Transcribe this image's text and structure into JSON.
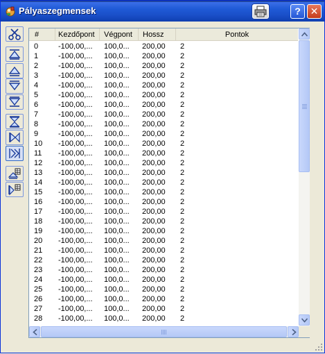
{
  "window": {
    "title": "Pályaszegmensek",
    "print_icon": "printer-icon",
    "help_label": "?",
    "close_label": "✕"
  },
  "toolbar": {
    "items": [
      {
        "name": "scissors-icon"
      },
      {
        "name": "move-to-top-icon"
      },
      {
        "name": "move-up-icon"
      },
      {
        "name": "move-down-icon"
      },
      {
        "name": "move-to-bottom-icon"
      },
      {
        "name": "flip-vertical-icon"
      },
      {
        "name": "flip-horizontal-icon"
      },
      {
        "name": "flip-both-icon"
      },
      {
        "name": "table-export-icon"
      },
      {
        "name": "table-import-icon"
      }
    ]
  },
  "table": {
    "columns": [
      "#",
      "Kezdőpont",
      "Végpont",
      "Hossz",
      "Pontok"
    ],
    "rows": [
      [
        "0",
        "-100,00,...",
        "100,0...",
        "200,00",
        "2"
      ],
      [
        "1",
        "-100,00,...",
        "100,0...",
        "200,00",
        "2"
      ],
      [
        "2",
        "-100,00,...",
        "100,0...",
        "200,00",
        "2"
      ],
      [
        "3",
        "-100,00,...",
        "100,0...",
        "200,00",
        "2"
      ],
      [
        "4",
        "-100,00,...",
        "100,0...",
        "200,00",
        "2"
      ],
      [
        "5",
        "-100,00,...",
        "100,0...",
        "200,00",
        "2"
      ],
      [
        "6",
        "-100,00,...",
        "100,0...",
        "200,00",
        "2"
      ],
      [
        "7",
        "-100,00,...",
        "100,0...",
        "200,00",
        "2"
      ],
      [
        "8",
        "-100,00,...",
        "100,0...",
        "200,00",
        "2"
      ],
      [
        "9",
        "-100,00,...",
        "100,0...",
        "200,00",
        "2"
      ],
      [
        "10",
        "-100,00,...",
        "100,0...",
        "200,00",
        "2"
      ],
      [
        "11",
        "-100,00,...",
        "100,0...",
        "200,00",
        "2"
      ],
      [
        "12",
        "-100,00,...",
        "100,0...",
        "200,00",
        "2"
      ],
      [
        "13",
        "-100,00,...",
        "100,0...",
        "200,00",
        "2"
      ],
      [
        "14",
        "-100,00,...",
        "100,0...",
        "200,00",
        "2"
      ],
      [
        "15",
        "-100,00,...",
        "100,0...",
        "200,00",
        "2"
      ],
      [
        "16",
        "-100,00,...",
        "100,0...",
        "200,00",
        "2"
      ],
      [
        "17",
        "-100,00,...",
        "100,0...",
        "200,00",
        "2"
      ],
      [
        "18",
        "-100,00,...",
        "100,0...",
        "200,00",
        "2"
      ],
      [
        "19",
        "-100,00,...",
        "100,0...",
        "200,00",
        "2"
      ],
      [
        "20",
        "-100,00,...",
        "100,0...",
        "200,00",
        "2"
      ],
      [
        "21",
        "-100,00,...",
        "100,0...",
        "200,00",
        "2"
      ],
      [
        "22",
        "-100,00,...",
        "100,0...",
        "200,00",
        "2"
      ],
      [
        "23",
        "-100,00,...",
        "100,0...",
        "200,00",
        "2"
      ],
      [
        "24",
        "-100,00,...",
        "100,0...",
        "200,00",
        "2"
      ],
      [
        "25",
        "-100,00,...",
        "100,0...",
        "200,00",
        "2"
      ],
      [
        "26",
        "-100,00,...",
        "100,0...",
        "200,00",
        "2"
      ],
      [
        "27",
        "-100,00,...",
        "100,0...",
        "200,00",
        "2"
      ],
      [
        "28",
        "-100,00,...",
        "100,0...",
        "200,00",
        "2"
      ]
    ]
  },
  "scrollbars": {
    "vertical_up_icon": "scroll-up-arrow-icon",
    "vertical_down_icon": "scroll-down-arrow-icon",
    "horizontal_left_icon": "scroll-left-arrow-icon",
    "horizontal_right_icon": "scroll-right-arrow-icon"
  }
}
